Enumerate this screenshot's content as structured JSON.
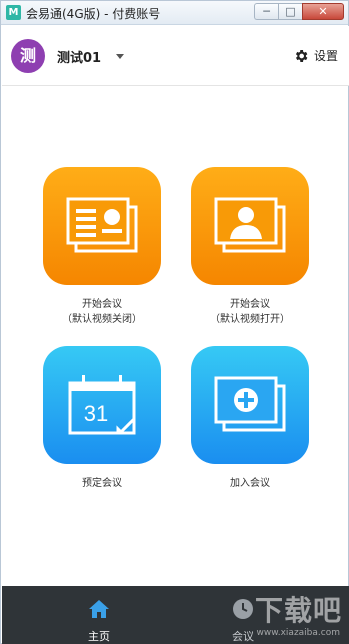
{
  "window": {
    "title": "会易通(4G版) - 付费账号",
    "logo_glyph": "M",
    "minimize_glyph": "─",
    "maximize_glyph": "□",
    "close_glyph": "✕"
  },
  "header": {
    "avatar_text": "测",
    "avatar_color": "#8e3fb1",
    "user_name": "测试01",
    "settings_label": "设置",
    "settings_icon": "gear-icon"
  },
  "tiles": [
    {
      "line1": "开始会议",
      "line2": "（默认视频关闭）",
      "icon": "presentation-icon",
      "color": "orange"
    },
    {
      "line1": "开始会议",
      "line2": "（默认视频打开）",
      "icon": "video-person-icon",
      "color": "orange"
    },
    {
      "line1": "预定会议",
      "line2": "",
      "icon": "calendar-icon",
      "calendar_day": "31",
      "color": "blue"
    },
    {
      "line1": "加入会议",
      "line2": "",
      "icon": "join-plus-icon",
      "color": "blue"
    }
  ],
  "bottom_nav": [
    {
      "label": "主页",
      "icon": "home-icon",
      "active": true
    },
    {
      "label": "会议",
      "icon": "clock-icon",
      "active": false
    }
  ],
  "colors": {
    "orange_top": "#ffad17",
    "orange_bottom": "#f58600",
    "blue_top": "#36c9f4",
    "blue_bottom": "#1a8ef0",
    "bottom_bar": "#2f3438"
  },
  "watermark": {
    "main": "下载吧",
    "sub": "www.xiazaiba.com"
  }
}
